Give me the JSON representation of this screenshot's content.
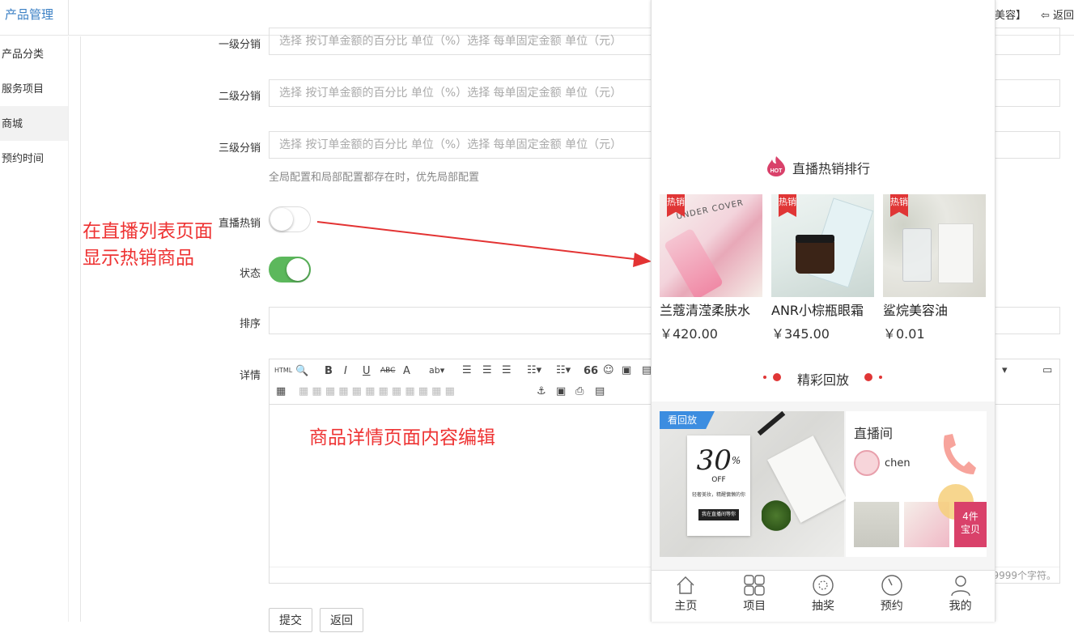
{
  "header": {
    "brand": "产品管理",
    "right_partial": "美容】",
    "back": "返回"
  },
  "sidebar": {
    "items": [
      {
        "label": "产品分类"
      },
      {
        "label": "服务项目"
      },
      {
        "label": "商城",
        "active": true
      },
      {
        "label": "预约时间"
      }
    ]
  },
  "form": {
    "level1": {
      "label": "一级分销",
      "placeholder": "选择 按订单金额的百分比 单位（%）选择 每单固定金额 单位（元）"
    },
    "level2": {
      "label": "二级分销",
      "placeholder": "选择 按订单金额的百分比 单位（%）选择 每单固定金额 单位（元）"
    },
    "level3": {
      "label": "三级分销",
      "placeholder": "选择 按订单金额的百分比 单位（%）选择 每单固定金额 单位（元）"
    },
    "hint": "全局配置和局部配置都存在时，优先局部配置",
    "live_hot": {
      "label": "直播热销",
      "on": false
    },
    "status": {
      "label": "状态",
      "on": true
    },
    "sort": {
      "label": "排序"
    },
    "detail": {
      "label": "详情",
      "char_count": "99999个字符。"
    },
    "submit": "提交",
    "back": "返回"
  },
  "annotations": {
    "live_list_line1": "在直播列表页面",
    "live_list_line2": "显示热销商品",
    "detail_edit": "商品详情页面内容编辑",
    "arrow_color": "#e33333"
  },
  "editor_toolbar": {
    "html": "HTML",
    "bold": "B",
    "italic": "I",
    "underline": "U",
    "strike": "ABC",
    "font": "A",
    "quote": "66"
  },
  "phone": {
    "hot_title": "直播热销排行",
    "hot_badge": "HOT",
    "products": [
      {
        "tag": "热销",
        "name": "兰蔻清滢柔肤水",
        "price": "￥420.00"
      },
      {
        "tag": "热销",
        "name": "ANR小棕瓶眼霜",
        "price": "￥345.00"
      },
      {
        "tag": "热销",
        "name": "鲨烷美容油",
        "price": "￥0.01"
      }
    ],
    "replay_title": "精彩回放",
    "replay": {
      "badge": "看回放",
      "promo_big": "30",
      "promo_pct": "%",
      "promo_off": "OFF",
      "promo_text": "轻奢美妆，精醒慵懒的你",
      "promo_btn": "我在直播间等你",
      "room_title": "直播间",
      "host": "chen",
      "count": "4件",
      "count_suffix": "宝贝"
    },
    "tabs": [
      {
        "label": "主页",
        "icon": "home-icon"
      },
      {
        "label": "项目",
        "icon": "grid-icon"
      },
      {
        "label": "抽奖",
        "icon": "lottery-icon"
      },
      {
        "label": "预约",
        "icon": "clock-icon"
      },
      {
        "label": "我的",
        "icon": "user-icon"
      }
    ],
    "accent": "#e03636"
  }
}
